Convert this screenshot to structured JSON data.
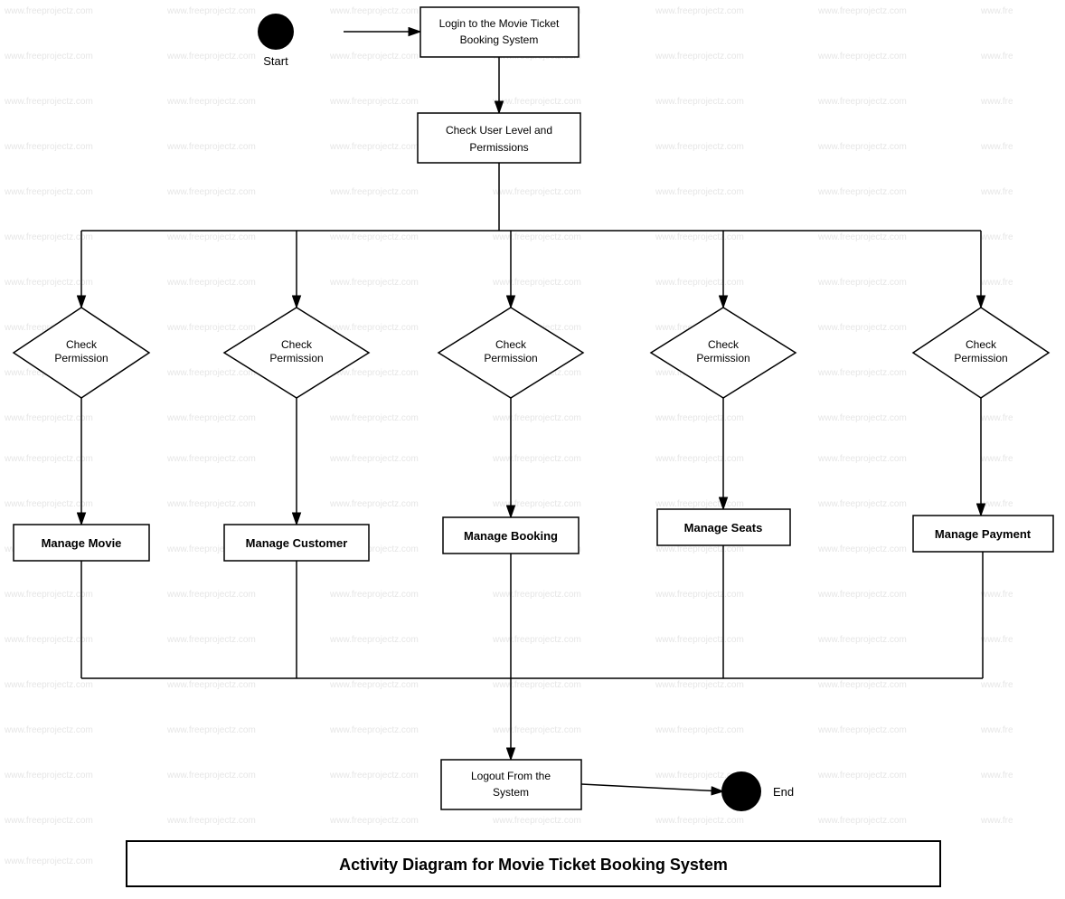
{
  "watermark": "www.freeprojectz.com",
  "diagram": {
    "title": "Activity Diagram for Movie Ticket Booking System",
    "nodes": {
      "start": {
        "label": "Start",
        "type": "circle"
      },
      "login": {
        "label": "Login to the Movie Ticket\nBooking System",
        "type": "rect"
      },
      "check_user_level": {
        "label": "Check User Level and\nPermissions",
        "type": "rect"
      },
      "check_perm1": {
        "label": "Check\nPermission",
        "type": "diamond"
      },
      "check_perm2": {
        "label": "Check\nPermission",
        "type": "diamond"
      },
      "check_perm3": {
        "label": "Check\nPermission",
        "type": "diamond"
      },
      "check_perm4": {
        "label": "Check\nPermission",
        "type": "diamond"
      },
      "check_perm5": {
        "label": "Check\nPermission",
        "type": "diamond"
      },
      "manage_movie": {
        "label": "Manage Movie",
        "type": "rect"
      },
      "manage_customer": {
        "label": "Manage Customer",
        "type": "rect"
      },
      "manage_booking": {
        "label": "Manage Booking",
        "type": "rect"
      },
      "manage_seats": {
        "label": "Manage Seats",
        "type": "rect"
      },
      "manage_payment": {
        "label": "Manage Payment",
        "type": "rect"
      },
      "logout": {
        "label": "Logout From the\nSystem",
        "type": "rect"
      },
      "end": {
        "label": "End",
        "type": "circle_filled"
      }
    }
  },
  "colors": {
    "black": "#000000",
    "white": "#ffffff",
    "gray": "#cccccc",
    "light_gray": "#f0f0f0"
  }
}
